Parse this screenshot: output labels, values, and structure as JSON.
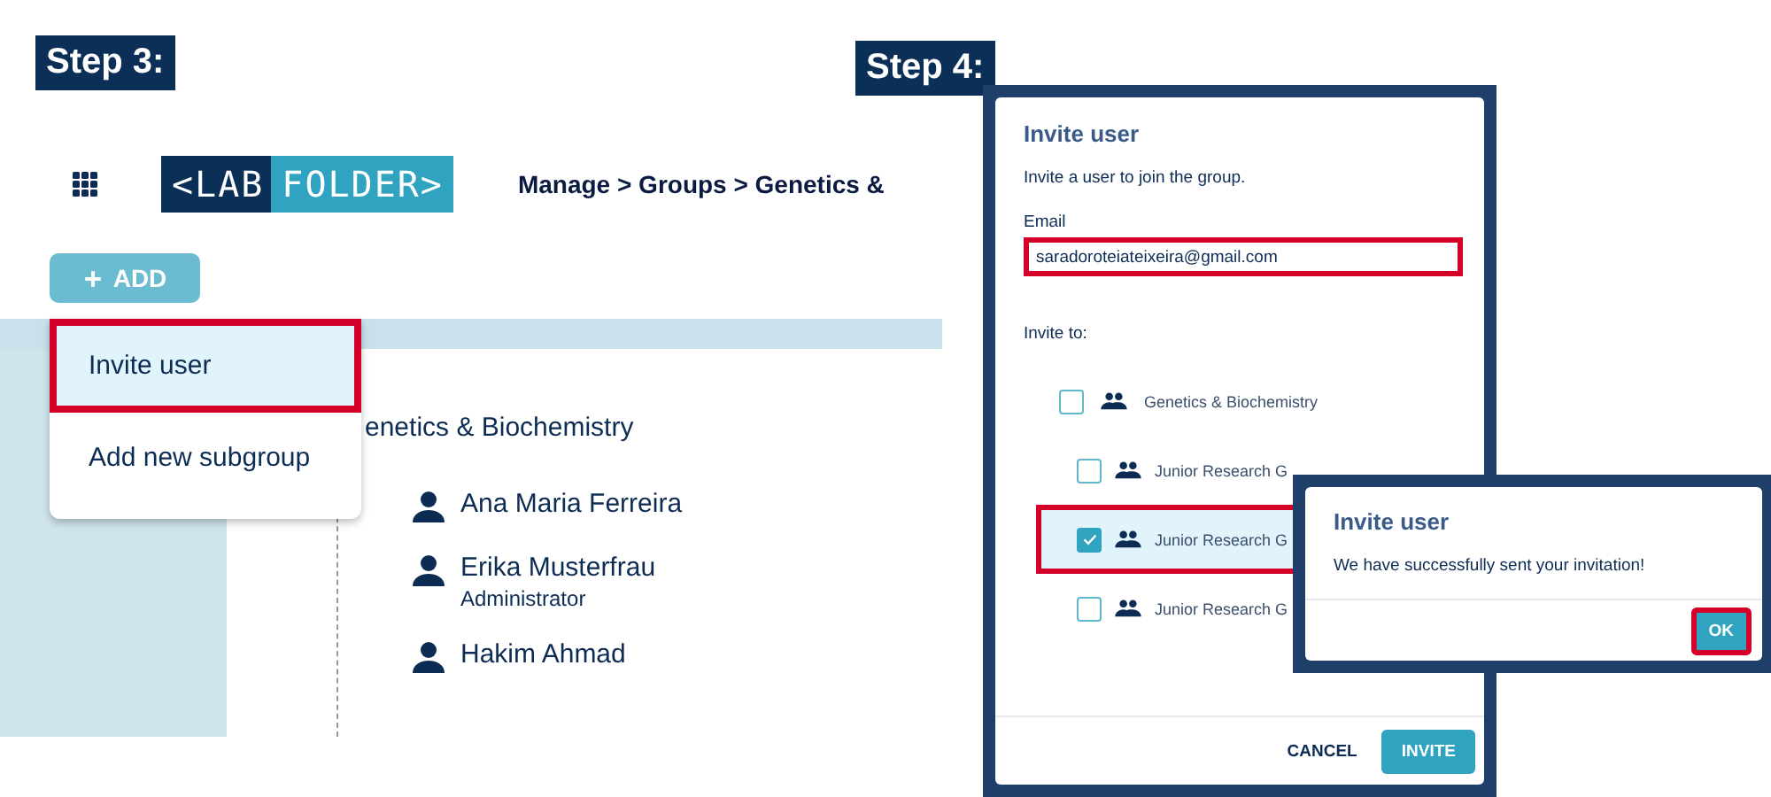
{
  "step3": {
    "label": "Step 3:",
    "logo": {
      "left": "<LAB",
      "right": "FOLDER>"
    },
    "breadcrumb": "Manage > Groups > Genetics &",
    "add_button": "ADD",
    "menu": [
      {
        "label": "Invite user",
        "selected": true
      },
      {
        "label": "Add new subgroup",
        "selected": false
      }
    ],
    "group_title": "enetics & Biochemistry",
    "members": [
      {
        "name": "Ana Maria Ferreira"
      },
      {
        "name": "Erika Musterfrau",
        "role": "Administrator"
      },
      {
        "name": "Hakim Ahmad"
      }
    ]
  },
  "step4": {
    "label": "Step 4:",
    "dialog": {
      "title": "Invite user",
      "description": "Invite a user to join the group.",
      "email_label": "Email",
      "email_value": "saradoroteiateixeira@gmail.com",
      "email_highlighted": true,
      "invite_to_label": "Invite to:",
      "groups": [
        {
          "label": "Genetics & Biochemistry",
          "checked": false,
          "selected": false,
          "children": [
            {
              "label": "Junior Research G",
              "checked": false,
              "selected": false
            },
            {
              "label": "Junior Research G",
              "checked": true,
              "selected": true
            },
            {
              "label": "Junior Research G",
              "checked": false,
              "selected": false
            }
          ]
        }
      ],
      "buttons": [
        {
          "label": "CANCEL",
          "kind": "text"
        },
        {
          "label": "INVITE",
          "kind": "primary"
        }
      ]
    },
    "success_dialog": {
      "title": "Invite user",
      "message": "We have successfully sent your invitation!",
      "ok_button": "OK",
      "ok_highlighted": true
    }
  }
}
